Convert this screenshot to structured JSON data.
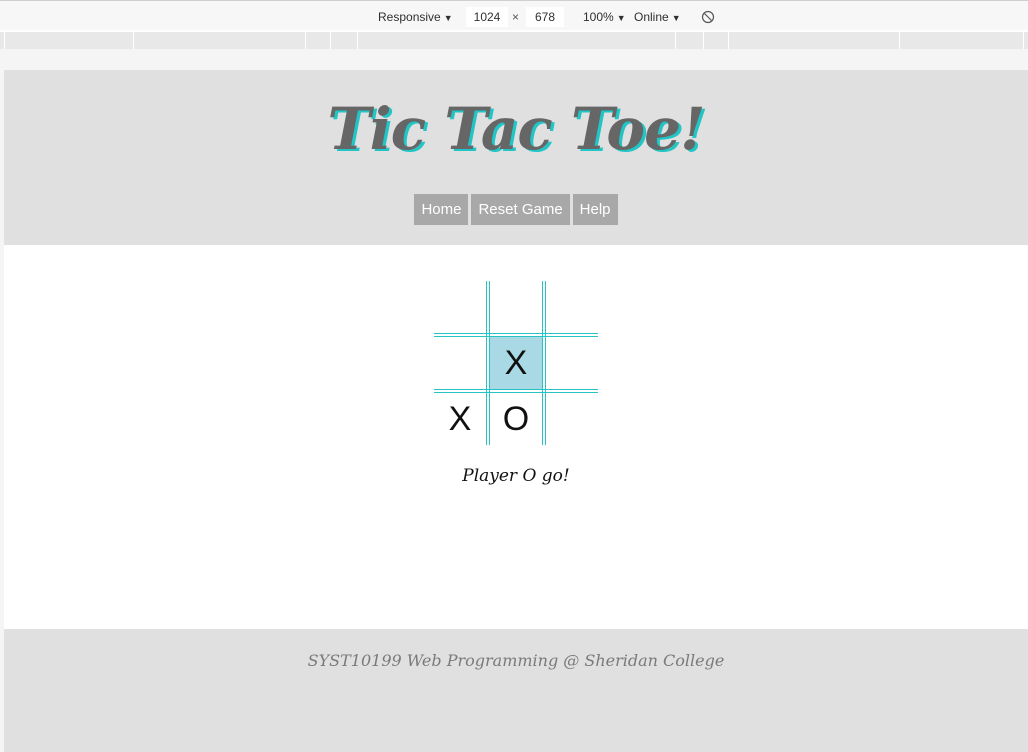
{
  "devtools": {
    "device": "Responsive",
    "width": "1024",
    "times": "×",
    "height": "678",
    "zoom": "100%",
    "network": "Online",
    "rotate_icon": "rotate-icon"
  },
  "header": {
    "title": "Tic Tac Toe!",
    "nav": [
      "Home",
      "Reset Game",
      "Help"
    ]
  },
  "board": {
    "cells": [
      "",
      "",
      "",
      "",
      "X",
      "",
      "X",
      "O",
      ""
    ],
    "highlighted_cell": 4
  },
  "status": "Player O go!",
  "footer": "SYST10199 Web Programming @ Sheridan College",
  "colors": {
    "header_bg": "#e0e0e0",
    "nav_bg": "#a8a8a8",
    "grid_line": "#27c2c2",
    "highlight": "#a9d9e4",
    "title_shadow": "#22c5c5"
  }
}
